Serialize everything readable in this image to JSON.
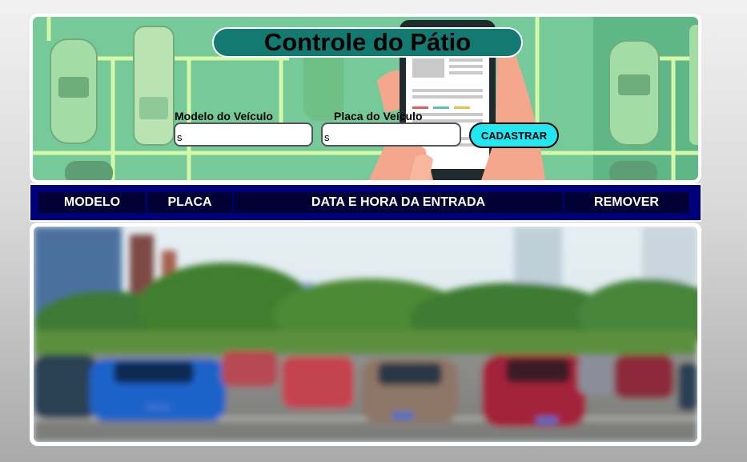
{
  "header": {
    "title": "Controle do Pátio"
  },
  "form": {
    "modelo_label": "Modelo do Veículo",
    "modelo_value": "s",
    "placa_label": "Placa do Veículo",
    "placa_value": "s",
    "cadastrar_label": "CADASTRAR"
  },
  "table": {
    "columns": [
      "MODELO",
      "PLACA",
      "DATA E HORA DA ENTRADA",
      "REMOVER"
    ]
  },
  "colors": {
    "title_bg": "#137a72",
    "button_bg": "#22e6f0",
    "table_header_bg": "#000035",
    "hero_green": "#7ccf9e"
  },
  "icons": [
    "parking-lot-illustration",
    "smartphone-illustration",
    "parking-lot-photo"
  ]
}
